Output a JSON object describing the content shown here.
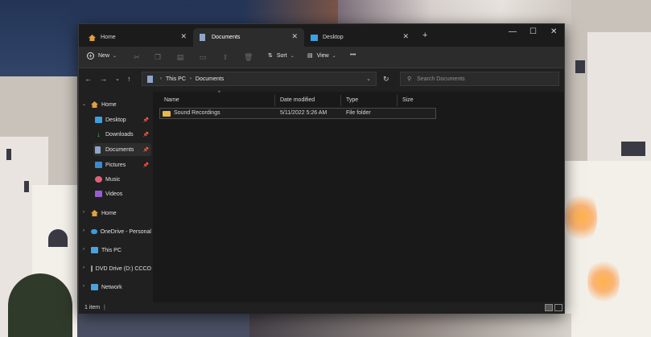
{
  "tabs": [
    {
      "label": "Home",
      "active": false
    },
    {
      "label": "Documents",
      "active": true
    },
    {
      "label": "Desktop",
      "active": false
    }
  ],
  "toolbar": {
    "new_label": "New",
    "sort_label": "Sort",
    "view_label": "View",
    "more_label": "•••"
  },
  "address": {
    "segments": [
      "This PC",
      "Documents"
    ],
    "search_placeholder": "Search Documents"
  },
  "sidebar": {
    "quick_access": [
      {
        "label": "Home",
        "icon": "home-icon"
      },
      {
        "label": "Desktop",
        "icon": "desktop-folder-icon",
        "pinned": true
      },
      {
        "label": "Downloads",
        "icon": "download-icon",
        "pinned": true
      },
      {
        "label": "Documents",
        "icon": "documents-icon",
        "pinned": true,
        "selected": true
      },
      {
        "label": "Pictures",
        "icon": "pictures-icon",
        "pinned": true
      },
      {
        "label": "Music",
        "icon": "music-icon"
      },
      {
        "label": "Videos",
        "icon": "videos-icon"
      }
    ],
    "roots": [
      {
        "label": "Home",
        "icon": "home-icon"
      },
      {
        "label": "OneDrive - Personal",
        "icon": "onedrive-icon"
      },
      {
        "label": "This PC",
        "icon": "pc-icon"
      },
      {
        "label": "DVD Drive (D:) CCCO",
        "icon": "dvd-icon"
      },
      {
        "label": "Network",
        "icon": "network-icon"
      }
    ]
  },
  "columns": [
    "Name",
    "Date modified",
    "Type",
    "Size"
  ],
  "files": [
    {
      "name": "Sound Recordings",
      "date": "5/11/2022 5:26 AM",
      "type": "File folder",
      "size": ""
    }
  ],
  "status": {
    "count_text": "1 item",
    "divider": "|"
  },
  "colors": {
    "window_bg": "#202020",
    "content_bg": "#191919",
    "folder": "#e8b84a",
    "accent": "#4aa3df"
  }
}
